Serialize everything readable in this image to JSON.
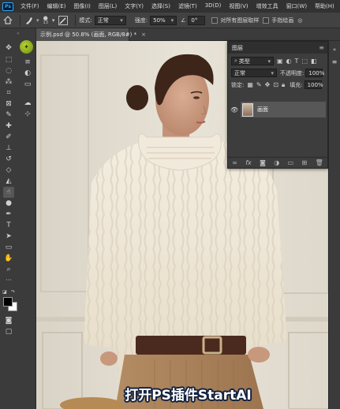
{
  "menubar": {
    "logo": "Ps",
    "items": [
      "文件(F)",
      "编辑(E)",
      "图像(I)",
      "图层(L)",
      "文字(Y)",
      "选择(S)",
      "滤镜(T)",
      "3D(D)",
      "视图(V)",
      "增效工具",
      "窗口(W)",
      "帮助(H)"
    ]
  },
  "options": {
    "brush_size": "13",
    "mode_label": "模式:",
    "mode_value": "正常",
    "strength_label": "强度:",
    "strength_value": "50%",
    "angle_value": "0°",
    "sample_all_label": "对所有图层取样",
    "finger_paint_label": "手指绘画"
  },
  "document": {
    "tab_title": "示例.psd @ 50.8% (画面, RGB/8#) *",
    "close": "×"
  },
  "layers_panel": {
    "title": "图层",
    "kind_filter": "类型",
    "blend_mode": "正常",
    "opacity_label": "不透明度:",
    "opacity_value": "100%",
    "lock_label": "锁定:",
    "fill_label": "填充:",
    "fill_value": "100%",
    "layer_name": "画面"
  },
  "subtitle": "打开PS插件StartAI",
  "colors": {
    "accent_active_tool": "#575757",
    "foreground_swatch": "#000000",
    "background_swatch": "#ffffff",
    "subtitle_outline": "#14233f"
  }
}
